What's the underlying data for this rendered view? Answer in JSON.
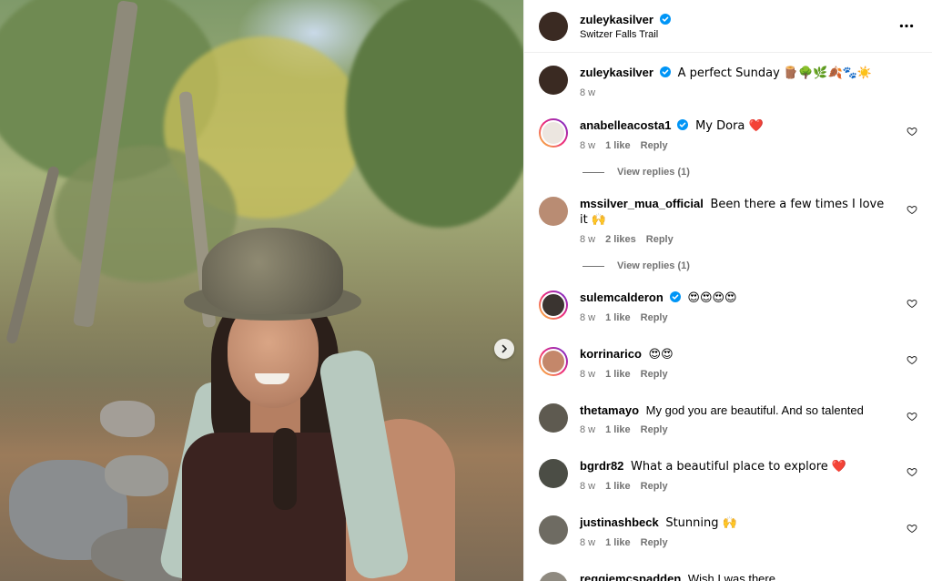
{
  "post": {
    "username": "zuleykasilver",
    "location": "Switzer Falls Trail",
    "caption": {
      "username": "zuleykasilver",
      "text": "A perfect Sunday 🪵🌳🌿🍂🐾☀️",
      "time": "8 w"
    }
  },
  "comments": [
    {
      "username": "anabelleacosta1",
      "verified": true,
      "text": "My Dora ❤️",
      "time": "8 w",
      "likes": "1 like",
      "reply": "Reply",
      "view_replies": "View replies (1)",
      "avatar_color": "#e9e2dc",
      "ring": true
    },
    {
      "username": "mssilver_mua_official",
      "verified": false,
      "text": "Been there a few times I love it 🙌",
      "time": "8 w",
      "likes": "2 likes",
      "reply": "Reply",
      "view_replies": "View replies (1)",
      "avatar_color": "#b98c73",
      "ring": false
    },
    {
      "username": "sulemcalderon",
      "verified": true,
      "text": "😍😍😍😍",
      "time": "8 w",
      "likes": "1 like",
      "reply": "Reply",
      "avatar_color": "#3a3430",
      "ring": true
    },
    {
      "username": "korrinarico",
      "verified": false,
      "text": "😍😍",
      "time": "8 w",
      "likes": "1 like",
      "reply": "Reply",
      "avatar_color": "#c4876a",
      "ring": true
    },
    {
      "username": "thetamayo",
      "verified": false,
      "text": "My god you are beautiful. And so talented",
      "time": "8 w",
      "likes": "1 like",
      "reply": "Reply",
      "avatar_color": "#5e5a50",
      "ring": false
    },
    {
      "username": "bgrdr82",
      "verified": false,
      "text": "What a beautiful place to explore ❤️",
      "time": "8 w",
      "likes": "1 like",
      "reply": "Reply",
      "avatar_color": "#4b4d45",
      "ring": false
    },
    {
      "username": "justinashbeck",
      "verified": false,
      "text": "Stunning 🙌",
      "time": "8 w",
      "likes": "1 like",
      "reply": "Reply",
      "avatar_color": "#6e6b62",
      "ring": false
    },
    {
      "username": "reggiemcspadden",
      "verified": false,
      "text": "Wish I was there",
      "avatar_color": "#8f8a80",
      "ring": false
    }
  ],
  "colors": {
    "verified": "#0095f6",
    "muted": "#737373",
    "heart": "#ed4956"
  },
  "icons": {
    "more": "more-horizontal-icon",
    "verified": "verified-badge-icon",
    "heart": "heart-outline-icon",
    "next": "chevron-right-icon"
  }
}
